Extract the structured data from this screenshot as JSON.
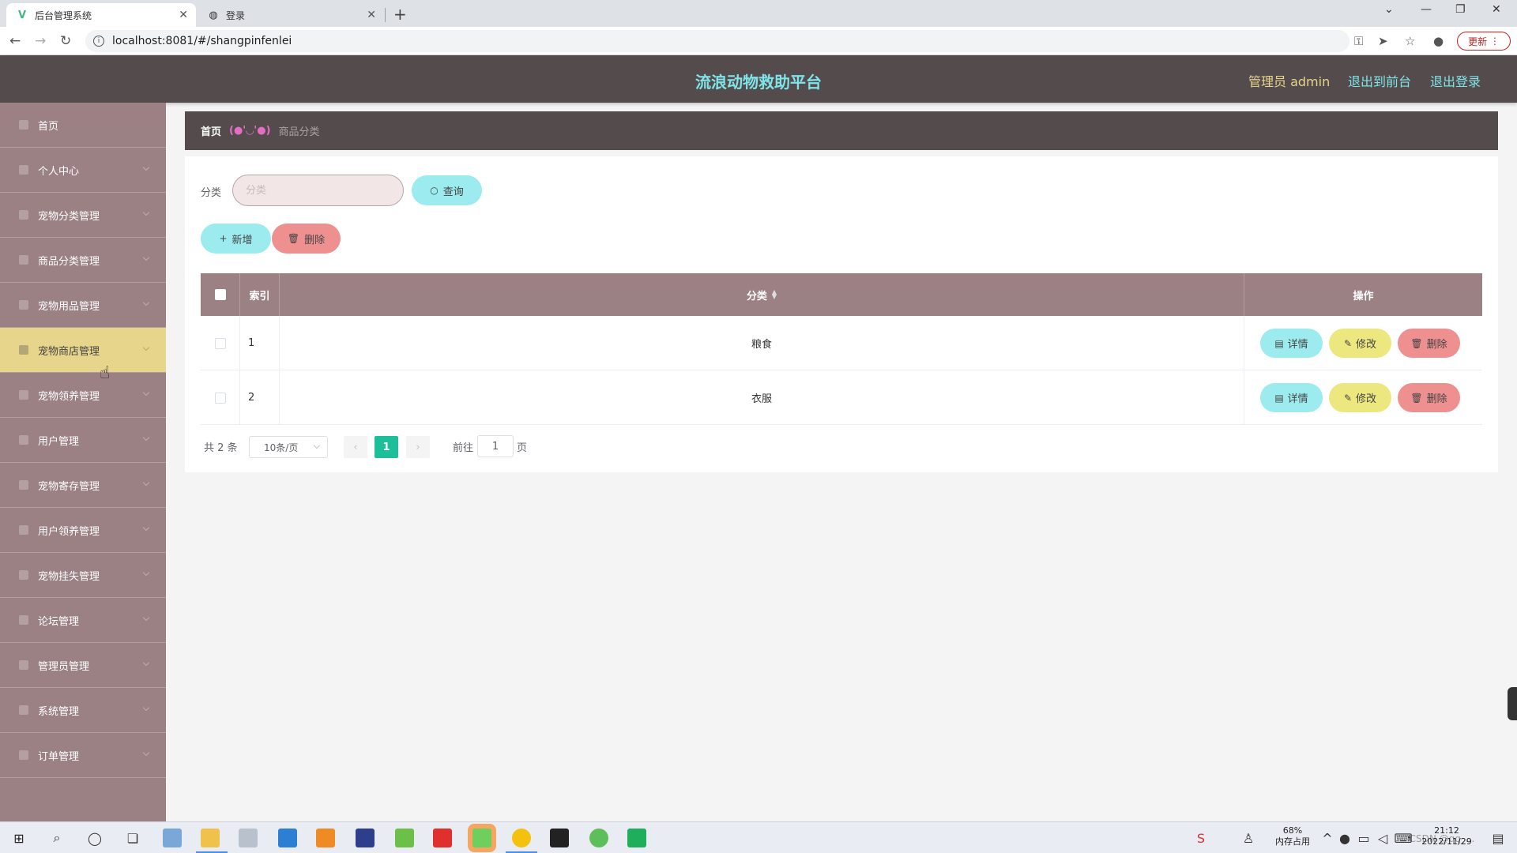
{
  "browser": {
    "tabs": [
      {
        "title": "后台管理系统",
        "active": true
      },
      {
        "title": "登录",
        "active": false
      }
    ],
    "url": "localhost:8081/#/shangpinfenlei",
    "update_label": "更新"
  },
  "header": {
    "title": "流浪动物救助平台",
    "admin_label": "管理员 admin",
    "front_link": "退出到前台",
    "logout_link": "退出登录",
    "colors": {
      "title": "#7fe4e8",
      "admin": "#e7d58b",
      "links": "#7fe4e8",
      "bg": "#544b4d"
    }
  },
  "sidebar": {
    "items": [
      {
        "label": "首页",
        "active": false
      },
      {
        "label": "个人中心",
        "active": false
      },
      {
        "label": "宠物分类管理",
        "active": false
      },
      {
        "label": "商品分类管理",
        "active": false
      },
      {
        "label": "宠物用品管理",
        "active": false
      },
      {
        "label": "宠物商店管理",
        "active": true
      },
      {
        "label": "宠物领养管理",
        "active": false
      },
      {
        "label": "用户管理",
        "active": false
      },
      {
        "label": "宠物寄存管理",
        "active": false
      },
      {
        "label": "用户领养管理",
        "active": false
      },
      {
        "label": "宠物挂失管理",
        "active": false
      },
      {
        "label": "论坛管理",
        "active": false
      },
      {
        "label": "管理员管理",
        "active": false
      },
      {
        "label": "系统管理",
        "active": false
      },
      {
        "label": "订单管理",
        "active": false
      }
    ]
  },
  "breadcrumb": {
    "home": "首页",
    "separator": "(●'◡'●)",
    "current": "商品分类"
  },
  "search": {
    "label": "分类",
    "placeholder": "分类",
    "query_button": "查询"
  },
  "actions": {
    "add_button": "新增",
    "delete_button": "删除"
  },
  "table": {
    "columns": {
      "index": "索引",
      "category": "分类",
      "operations": "操作"
    },
    "rows": [
      {
        "index": "1",
        "category": "粮食"
      },
      {
        "index": "2",
        "category": "衣服"
      }
    ],
    "row_buttons": {
      "detail": "详情",
      "edit": "修改",
      "delete": "删除"
    }
  },
  "pagination": {
    "total": "共 2 条",
    "page_size": "10条/页",
    "current_page": "1",
    "goto_label": "前往",
    "goto_value": "1",
    "page_suffix": "页"
  },
  "taskbar": {
    "memory_percent": "68%",
    "memory_label": "内存占用",
    "time": "21:12",
    "date": "2022/11/29",
    "watermark": "CSDN @qq_... "
  }
}
